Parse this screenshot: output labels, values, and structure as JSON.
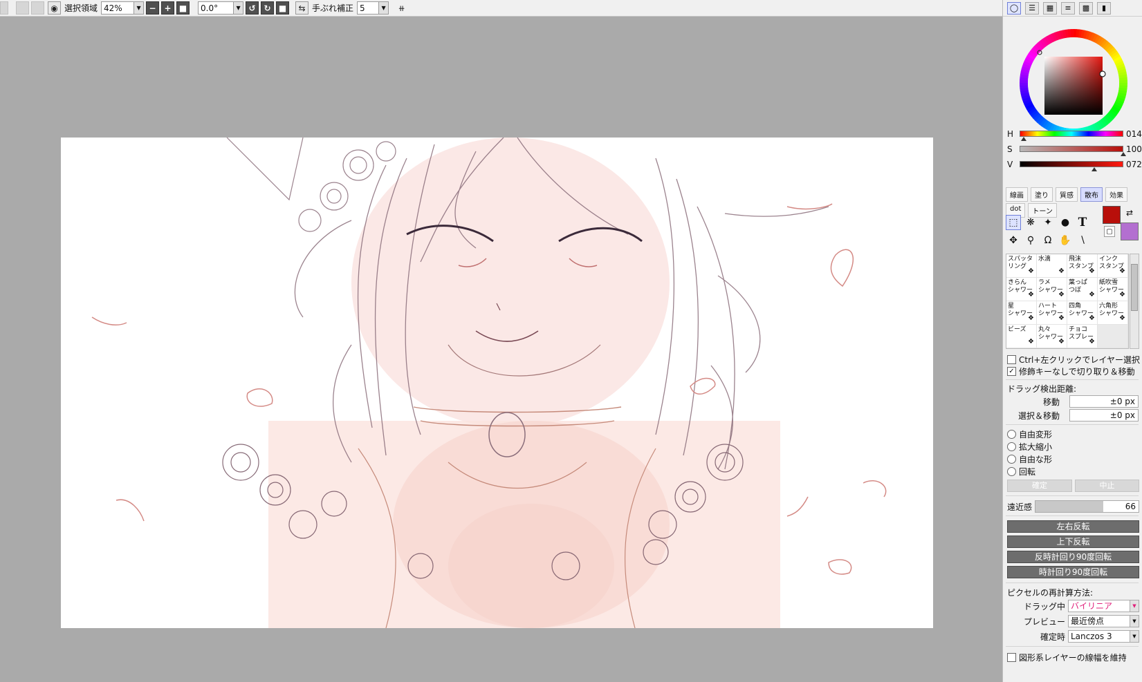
{
  "toolbar": {
    "selection_label": "選択領域",
    "zoom_value": "42%",
    "angle_value": "0.0°",
    "stabilizer_label": "手ぶれ補正",
    "stabilizer_value": "5"
  },
  "color": {
    "h_label": "H",
    "h_value": "014",
    "s_label": "S",
    "s_value": "100",
    "v_label": "V",
    "v_value": "072",
    "h_fraction": 0.04,
    "s_fraction": 1.0,
    "v_fraction": 0.72,
    "fg_color": "#b80f0a",
    "bg_color": "#b36fd0"
  },
  "brush_tabs": {
    "row1": [
      "線画",
      "塗り",
      "質感",
      "散布",
      "効果"
    ],
    "row2": [
      "dot",
      "トーン"
    ],
    "active": "散布"
  },
  "brushes": [
    [
      "スパッタ",
      "リング"
    ],
    [
      "水滴",
      ""
    ],
    [
      "飛沫",
      "スタンプ"
    ],
    [
      "インク",
      "スタンプ"
    ],
    [
      "きらん",
      "シャワー"
    ],
    [
      "ラメ",
      "シャワー"
    ],
    [
      "葉っぱ",
      "つぼ"
    ],
    [
      "紙吹雪",
      "シャワー"
    ],
    [
      "星",
      "シャワー"
    ],
    [
      "ハート",
      "シャワー"
    ],
    [
      "四角",
      "シャワー"
    ],
    [
      "六角形",
      "シャワー"
    ],
    [
      "ビーズ",
      ""
    ],
    [
      "丸々",
      "シャワー"
    ],
    [
      "チョコ",
      "スプレー"
    ]
  ],
  "options": {
    "ctrl_click_label": "Ctrl+左クリックでレイヤー選択",
    "modifier_label": "修飾キーなしで切り取り＆移動",
    "drag_distance_label": "ドラッグ検出距離:",
    "move_label": "移動",
    "move_value": "±0 px",
    "select_move_label": "選択＆移動",
    "select_move_value": "±0 px",
    "free_transform": "自由変形",
    "scale": "拡大縮小",
    "free_shape": "自由な形",
    "rotate": "回転",
    "confirm": "確定",
    "cancel": "中止",
    "perspective_label": "遠近感",
    "perspective_value": "66",
    "perspective_fraction": 0.66,
    "flip_h": "左右反転",
    "flip_v": "上下反転",
    "rotate_ccw": "反時計回り90度回転",
    "rotate_cw": "時計回り90度回転",
    "resample_label": "ピクセルの再計算方法:",
    "dragging_label": "ドラッグ中",
    "dragging_value": "バイリニア",
    "preview_label": "プレビュー",
    "preview_value": "最近傍点",
    "confirm_label": "確定時",
    "confirm_value": "Lanczos 3",
    "keep_stroke_label": "図形系レイヤーの線幅を維持"
  }
}
